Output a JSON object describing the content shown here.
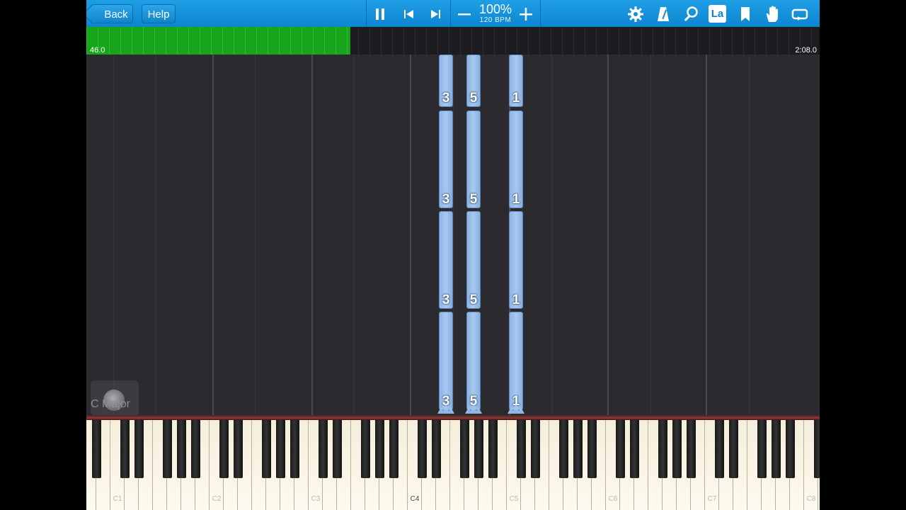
{
  "toolbar": {
    "back_label": "Back",
    "help_label": "Help",
    "tempo_percent": "100%",
    "tempo_bpm": "120 BPM",
    "icons": [
      "pause-icon",
      "skip-start-icon",
      "skip-end-icon",
      "minus-icon",
      "plus-icon",
      "gear-icon",
      "metronome-icon",
      "magnifier-icon",
      "la-icon",
      "bookmark-icon",
      "hand-icon",
      "loop-icon"
    ],
    "la_label": "La"
  },
  "progress": {
    "fraction": 0.36,
    "start_time": "46.0",
    "end_time": "2:08.0",
    "fill_color": "#18a51c"
  },
  "key_signature": "C Major",
  "notes": {
    "fingers": [
      "3",
      "5",
      "1"
    ],
    "color": "#a9c8f0"
  },
  "piano": {
    "octave_labels": [
      "C1",
      "C2",
      "C3",
      "C4",
      "C5",
      "C6",
      "C7",
      "C8"
    ],
    "active_label": "C4"
  },
  "colors": {
    "toolbar": "#1196db",
    "background": "#2b2a2f"
  }
}
